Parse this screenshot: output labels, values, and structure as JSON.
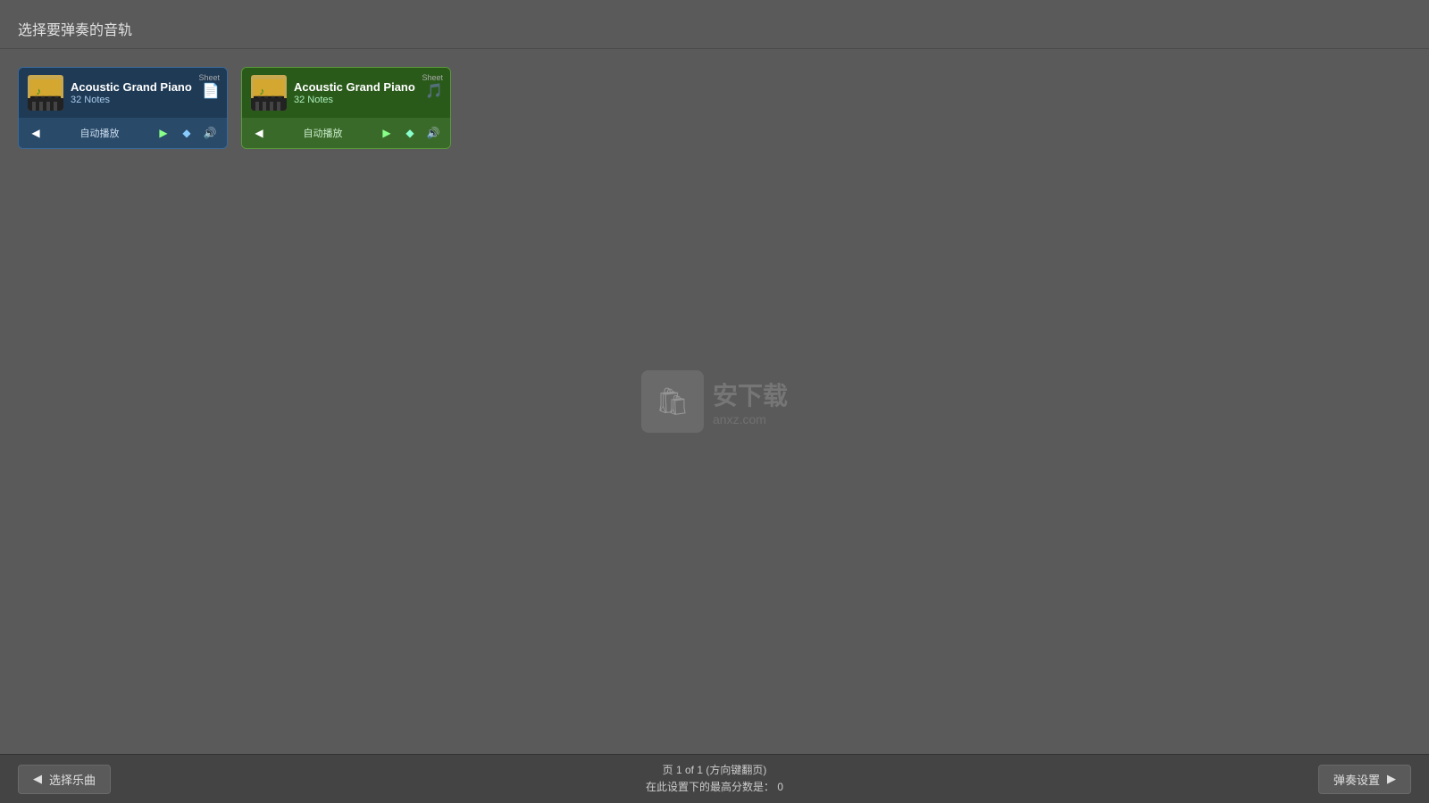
{
  "header": {
    "title": "选择要弹奏的音轨"
  },
  "tracks": [
    {
      "id": "track-1",
      "style": "blue",
      "name": "Acoustic Grand Piano",
      "notes": "32 Notes",
      "sheet_label": "Sheet",
      "auto_play": "自动播放"
    },
    {
      "id": "track-2",
      "style": "green",
      "name": "Acoustic Grand Piano",
      "notes": "32 Notes",
      "sheet_label": "Sheet",
      "auto_play": "自动播放"
    }
  ],
  "watermark": {
    "text": "安下载",
    "subtext": "anxz.com"
  },
  "footer": {
    "back_button_label": "选择乐曲",
    "page_info_line1": "页 1 of 1 (方向键翻页)",
    "page_info_line2": "在此设置下的最高分数是：",
    "max_score": "0",
    "settings_button_label": "弹奏设置"
  },
  "icons": {
    "back_arrow": "◀",
    "forward_arrow": "▶",
    "rewind": "◀",
    "play": "▶",
    "diamond": "◆",
    "volume": "◀)",
    "music_note": "♪"
  }
}
